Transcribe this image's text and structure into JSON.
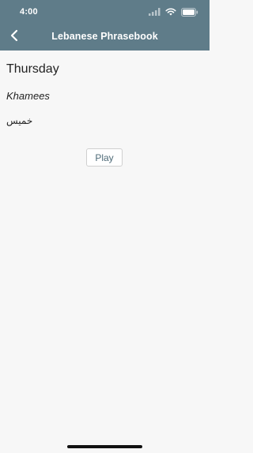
{
  "status_bar": {
    "time": "4:00",
    "icons": [
      "signal-icon",
      "wifi-icon",
      "battery-icon"
    ]
  },
  "nav": {
    "back_icon": "chevron-left-icon",
    "title": "Lebanese Phrasebook"
  },
  "phrase": {
    "english": "Thursday",
    "transliteration": "Khamees",
    "arabic": "خميس"
  },
  "actions": {
    "play_label": "Play"
  },
  "colors": {
    "header_bg": "#5f7c89",
    "header_text": "#ffffff",
    "page_bg": "#f7f7f7",
    "text": "#222222",
    "play_text": "#4f6b78"
  }
}
